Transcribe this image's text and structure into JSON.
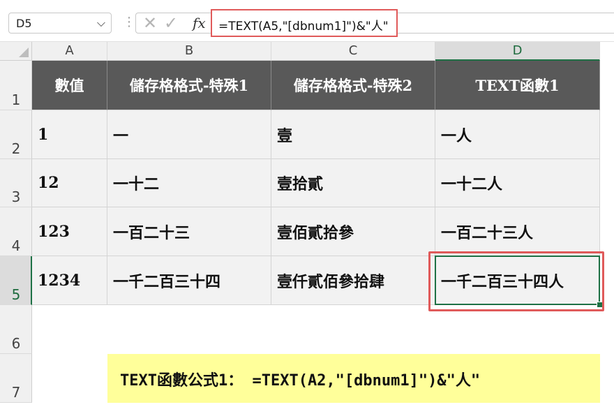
{
  "formula_bar": {
    "name_box": "D5",
    "name_box_arrow": "⌵",
    "more_icon": "⋮",
    "cancel_icon": "✕",
    "enter_icon": "✓",
    "fx_label": "fx",
    "formula": "=TEXT(A5,\"[dbnum1]\")&\"人\""
  },
  "columns": [
    "A",
    "B",
    "C",
    "D"
  ],
  "rows": [
    "1",
    "2",
    "3",
    "4",
    "5",
    "6",
    "7"
  ],
  "table": {
    "headers": [
      "數值",
      "儲存格格式-特殊1",
      "儲存格格式-特殊2",
      "TEXT函數1"
    ],
    "rows": [
      [
        "1",
        "一",
        "壹",
        "一人"
      ],
      [
        "12",
        "一十二",
        "壹拾貳",
        "一十二人"
      ],
      [
        "123",
        "一百二十三",
        "壹佰貳拾參",
        "一百二十三人"
      ],
      [
        "1234",
        "一千二百三十四",
        "壹仟貳佰參拾肆",
        "一千二百三十四人"
      ]
    ]
  },
  "note": {
    "text": "TEXT函數公式1： =TEXT(A2,\"[dbnum1]\")&\"人\""
  },
  "selected_cell": "D5",
  "colors": {
    "header_fill": "#595959",
    "cell_fill": "#f2f2f2",
    "selection": "#1e7145",
    "highlight": "#e05a5a",
    "note_fill": "#ffff9a"
  }
}
